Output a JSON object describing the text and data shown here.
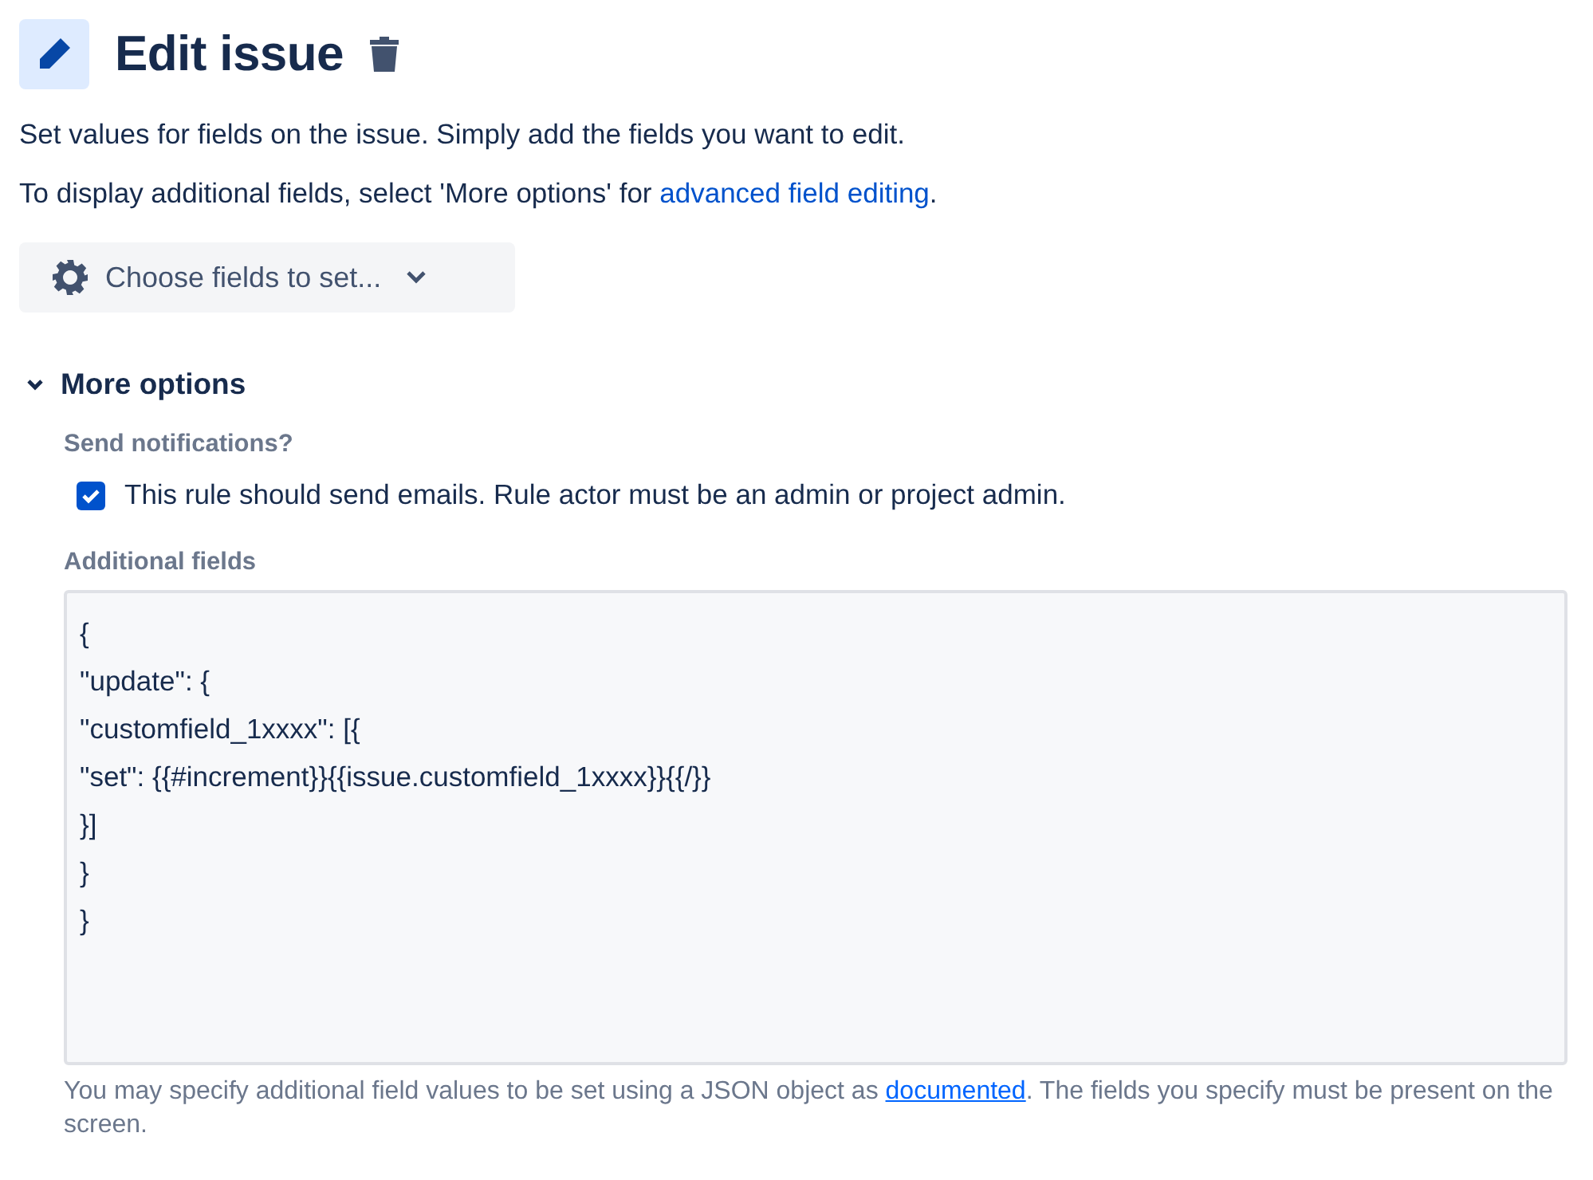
{
  "header": {
    "title": "Edit issue"
  },
  "intro": "Set values for fields on the issue. Simply add the fields you want to edit.",
  "advanced_note": {
    "before": "To display additional fields, select 'More options' for ",
    "link": "advanced field editing",
    "after": "."
  },
  "fields_button": {
    "label": "Choose fields to set..."
  },
  "more_options": {
    "label": "More options",
    "expanded": true,
    "notifications": {
      "label": "Send notifications?",
      "checkbox": {
        "label": "This rule should send emails. Rule actor must be an admin or project admin.",
        "checked": true
      }
    },
    "additional_fields": {
      "label": "Additional fields",
      "value": [
        "{",
        "\"update\": {",
        "\"customfield_1xxxx\": [{",
        "\"set\": {{#increment}}{{issue.customfield_1xxxx}}{{/}}",
        "}]",
        "}",
        "}"
      ],
      "help": {
        "before": "You may specify additional field values to be set using a JSON object as ",
        "link": "documented",
        "after": ". The fields you specify must be present on the screen."
      }
    }
  }
}
